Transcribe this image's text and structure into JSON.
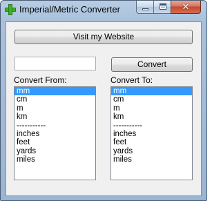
{
  "window": {
    "title": "Imperial/Metric Converter"
  },
  "controls": {
    "minimize_icon": "minimize-icon",
    "maximize_icon": "maximize-icon",
    "close_glyph": "✕"
  },
  "form": {
    "website_button": "Visit my Website",
    "value_input": "",
    "convert_button": "Convert",
    "from_label": "Convert From:",
    "to_label": "Convert To:"
  },
  "units_from": [
    "mm",
    "cm",
    "m",
    "km",
    "-----------",
    "inches",
    "feet",
    "yards",
    "miles"
  ],
  "units_to": [
    "mm",
    "cm",
    "m",
    "km",
    "-----------",
    "inches",
    "feet",
    "yards",
    "miles"
  ],
  "selected_from": "mm",
  "selected_to": "mm",
  "colors": {
    "selection": "#3399ff",
    "app_icon": "#3fae2a"
  }
}
